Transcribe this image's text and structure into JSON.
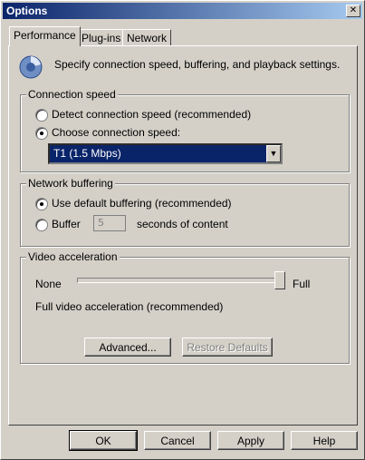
{
  "window": {
    "title": "Options",
    "close": "✕"
  },
  "tabs": [
    {
      "label": "Performance"
    },
    {
      "label": "Plug-ins"
    },
    {
      "label": "Network"
    }
  ],
  "intro": {
    "icon": "performance-gauge-icon",
    "text": "Specify connection speed, buffering, and playback settings."
  },
  "connection": {
    "legend": "Connection speed",
    "detect_label": "Detect connection speed (recommended)",
    "choose_label": "Choose connection speed:",
    "selected": "choose",
    "speed_value": "T1    (1.5 Mbps)"
  },
  "buffering": {
    "legend": "Network buffering",
    "default_label": "Use default buffering (recommended)",
    "buffer_label": "Buffer",
    "seconds_value": "5",
    "seconds_suffix": "seconds of content",
    "selected": "default"
  },
  "video": {
    "legend": "Video acceleration",
    "none_label": "None",
    "full_label": "Full",
    "level": 1.0,
    "status": "Full video acceleration (recommended)",
    "advanced_button": "Advanced...",
    "restore_button": "Restore Defaults"
  },
  "footer": {
    "ok": "OK",
    "cancel": "Cancel",
    "apply": "Apply",
    "help": "Help"
  },
  "colors": {
    "title_start": "#0a246a",
    "title_end": "#a6caf0",
    "face": "#d4d0c8",
    "selection": "#0a246a"
  }
}
